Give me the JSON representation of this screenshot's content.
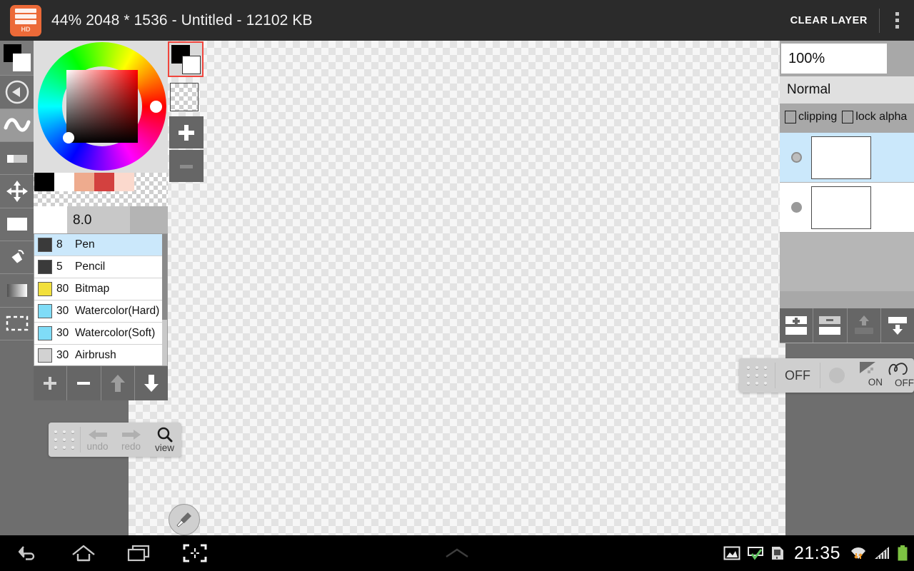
{
  "header": {
    "logo_label": "HD",
    "logo_icon": "hd-layers-icon",
    "title": "44% 2048 * 1536 - Untitled - 12102 KB",
    "clear_layer_label": "CLEAR LAYER",
    "overflow_icon": "more-vertical-icon"
  },
  "toolrail": {
    "items": [
      {
        "name": "color-swatch-tool",
        "icon": "color-swatch-icon",
        "active": false
      },
      {
        "name": "back-tool",
        "icon": "play-back-circle-icon",
        "active": false
      },
      {
        "name": "brush-tool",
        "icon": "squiggle-brush-icon",
        "active": true
      },
      {
        "name": "eraser-tool",
        "icon": "eraser-icon",
        "active": false
      },
      {
        "name": "move-tool",
        "icon": "move-arrows-icon",
        "active": false
      },
      {
        "name": "fill-rect-tool",
        "icon": "filled-rectangle-icon",
        "active": false
      },
      {
        "name": "bucket-tool",
        "icon": "paint-bucket-icon",
        "active": false
      },
      {
        "name": "gradient-tool",
        "icon": "gradient-icon",
        "active": false
      },
      {
        "name": "select-tool",
        "icon": "marquee-select-icon",
        "active": false
      }
    ]
  },
  "color_picker": {
    "hue_knob_label": "hue-handle",
    "sv_knob_label": "saturation-value-handle",
    "palette": [
      {
        "name": "palette-swatch-black",
        "color": "#000000"
      },
      {
        "name": "palette-swatch-white",
        "color": "#ffffff"
      },
      {
        "name": "palette-swatch-peach",
        "color": "#eeab8e"
      },
      {
        "name": "palette-swatch-red",
        "color": "#d3413f"
      },
      {
        "name": "palette-swatch-pink",
        "color": "#fbd9cd"
      }
    ],
    "current_fg": "#000000",
    "current_bg": "#ffffff",
    "add_label": "add-color",
    "remove_label": "remove-color"
  },
  "brush_size": {
    "value": "8.0"
  },
  "brushes": {
    "columns": [
      "size",
      "name"
    ],
    "rows": [
      {
        "size": "8",
        "name": "Pen",
        "chip": "#3a3a3a",
        "selected": true
      },
      {
        "size": "5",
        "name": "Pencil",
        "chip": "#3a3a3a",
        "selected": false
      },
      {
        "size": "80",
        "name": "Bitmap",
        "chip": "#f2e03c",
        "selected": false
      },
      {
        "size": "30",
        "name": "Watercolor(Hard)",
        "chip": "#7fdcf7",
        "selected": false
      },
      {
        "size": "30",
        "name": "Watercolor(Soft)",
        "chip": "#7fdcf7",
        "selected": false
      },
      {
        "size": "30",
        "name": "Airbrush",
        "chip": "#d2d2d2",
        "selected": false
      }
    ],
    "buttons": [
      {
        "name": "add-brush-button",
        "icon": "plus-icon",
        "enabled": true
      },
      {
        "name": "remove-brush-button",
        "icon": "minus-icon",
        "enabled": true
      },
      {
        "name": "move-brush-up-button",
        "icon": "arrow-up-icon",
        "enabled": false
      },
      {
        "name": "move-brush-down-button",
        "icon": "arrow-down-icon",
        "enabled": true
      }
    ]
  },
  "layer_panel": {
    "opacity": "100%",
    "blend_mode": "Normal",
    "clipping_label": "clipping",
    "clipping_checked": false,
    "lock_alpha_label": "lock alpha",
    "lock_alpha_checked": false,
    "layers": [
      {
        "name": "layer-row-1",
        "selected": true,
        "visible": true
      },
      {
        "name": "layer-row-2",
        "selected": false,
        "visible": true
      }
    ],
    "buttons": [
      {
        "name": "add-layer-button",
        "icon": "add-layer-icon",
        "enabled": true
      },
      {
        "name": "delete-layer-button",
        "icon": "delete-layer-icon",
        "enabled": true
      },
      {
        "name": "merge-up-button",
        "icon": "merge-up-icon",
        "enabled": false
      },
      {
        "name": "merge-down-button",
        "icon": "merge-down-icon",
        "enabled": true
      }
    ]
  },
  "float_left": {
    "grip_label": "drag-handle",
    "undo_label": "undo",
    "redo_label": "redo",
    "view_label": "view"
  },
  "float_right": {
    "grip_label": "drag-handle",
    "stabilizer_label": "OFF",
    "antialias_label": "ON",
    "correction_label": "OFF"
  },
  "eyedropper": {
    "icon": "eyedropper-icon"
  },
  "navbar": {
    "buttons": [
      {
        "name": "nav-back-button",
        "icon": "back-arrow-icon"
      },
      {
        "name": "nav-home-button",
        "icon": "home-icon"
      },
      {
        "name": "nav-recents-button",
        "icon": "recents-icon"
      },
      {
        "name": "nav-screenshot-button",
        "icon": "shrink-frame-icon"
      }
    ],
    "expand_icon": "chevron-up-icon",
    "status": {
      "image_icon": "image-saved-icon",
      "screencast_icon": "screen-check-icon",
      "sim_icon": "sim-card-icon",
      "clock": "21:35",
      "wifi_icon": "wifi-transfer-icon",
      "signal_icon": "signal-bars-icon",
      "battery_icon": "battery-full-icon"
    }
  },
  "colors": {
    "accent_orange": "#ec6a38",
    "selection_blue": "#cbe8fb",
    "header_bg": "#2b2b2b",
    "panel_gray": "#6e6e6e",
    "highlight_red": "#f1453d"
  }
}
